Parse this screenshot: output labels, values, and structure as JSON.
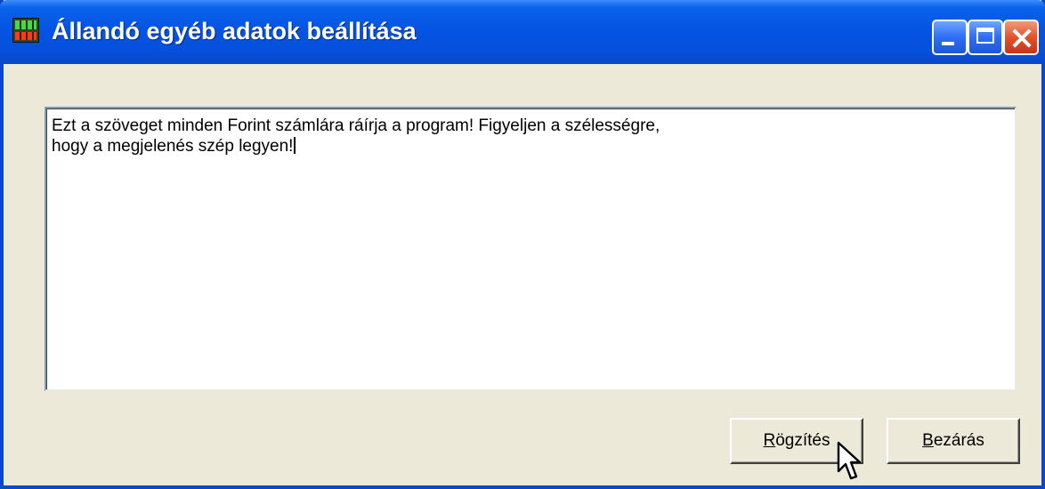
{
  "window": {
    "title": "Állandó egyéb adatok beállítása",
    "icon": "app-icon"
  },
  "titlebar_buttons": {
    "minimize": "minimize-icon",
    "maximize": "maximize-icon",
    "close": "close-icon"
  },
  "memo": {
    "line1": "Ezt a szöveget minden Forint számlára ráírja a program! Figyeljen a szélességre,",
    "line2": "hogy a megjelenés szép legyen!"
  },
  "buttons": {
    "save_accel": "R",
    "save_rest": "ögzítés",
    "close_accel": "B",
    "close_rest": "ezárás"
  },
  "colors": {
    "titlebar": "#0554e3",
    "window_bg": "#ece9d8",
    "close_button": "#e3522c"
  }
}
